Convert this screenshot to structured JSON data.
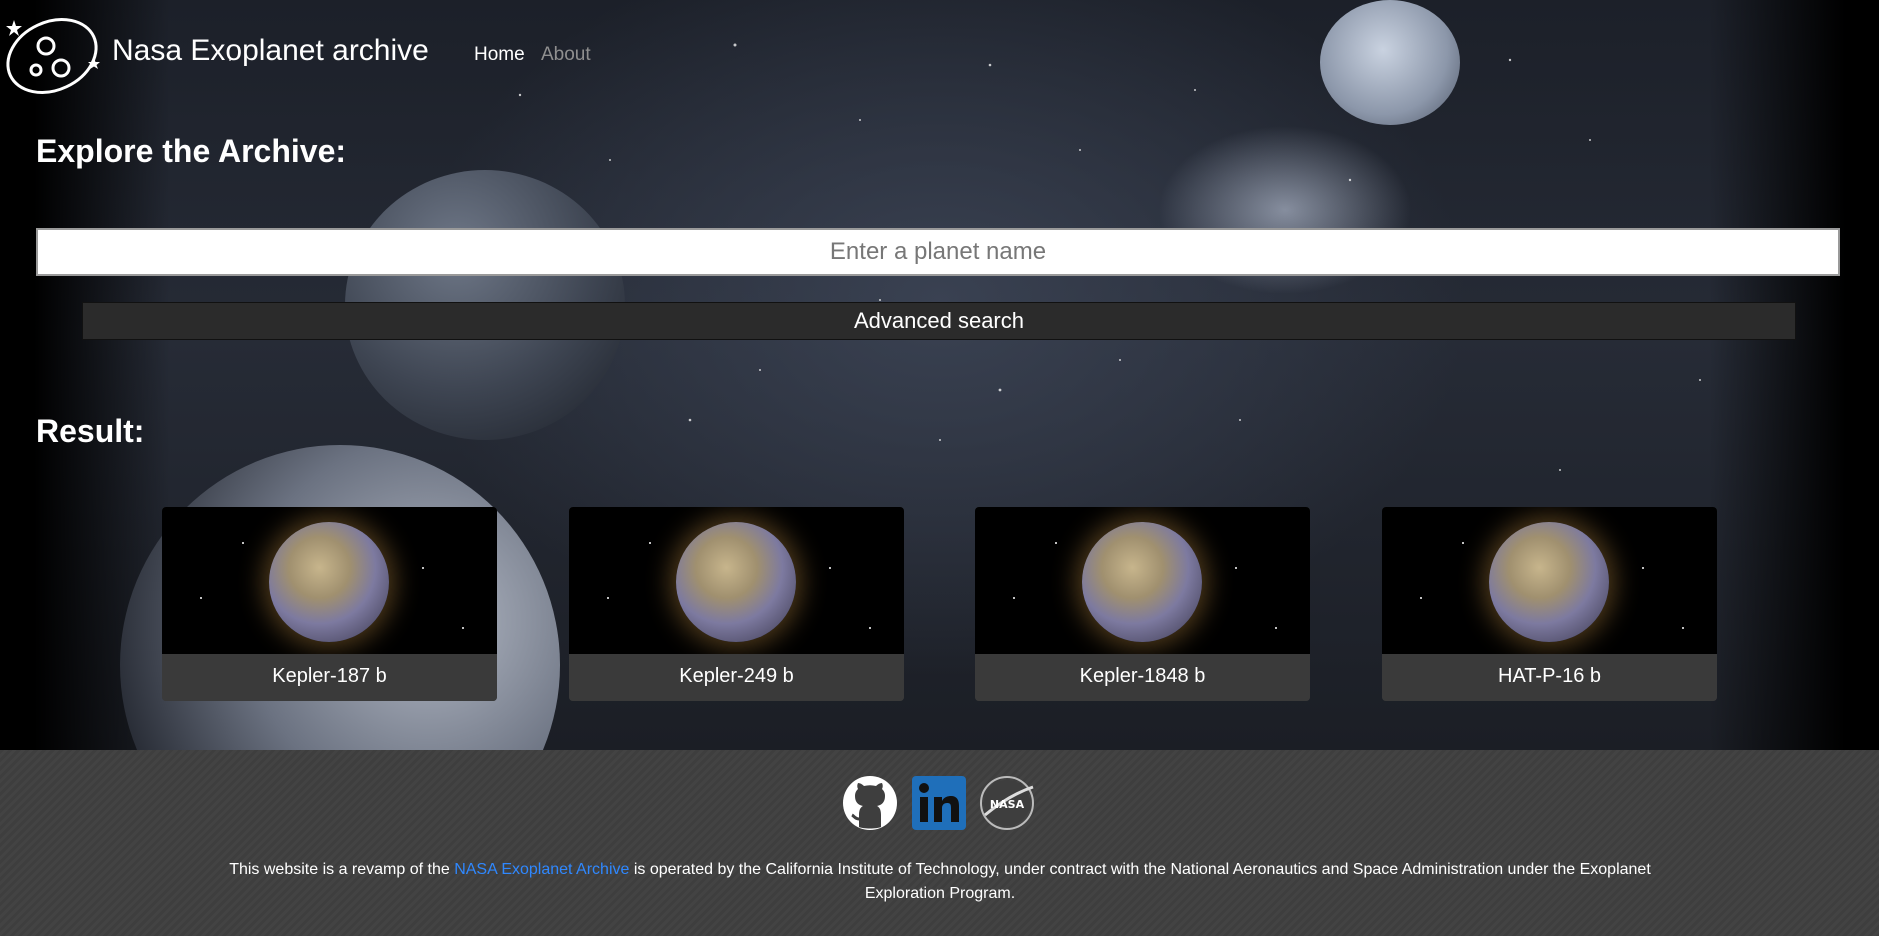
{
  "nav": {
    "brand": "Nasa Exoplanet archive",
    "links": [
      {
        "label": "Home",
        "active": true
      },
      {
        "label": "About",
        "active": false
      }
    ]
  },
  "explore": {
    "title": "Explore the Archive:",
    "search_placeholder": "Enter a planet name",
    "advanced_label": "Advanced search"
  },
  "results": {
    "title": "Result:",
    "cards": [
      {
        "name": "Kepler-187 b"
      },
      {
        "name": "Kepler-249 b"
      },
      {
        "name": "Kepler-1848 b"
      },
      {
        "name": "HAT-P-16 b"
      }
    ]
  },
  "footer": {
    "icons": [
      "github-icon",
      "linkedin-icon",
      "nasa-icon"
    ],
    "text_before": "This website is a revamp of the ",
    "link_text": "NASA Exoplanet Archive",
    "text_after": " is operated by the California Institute of Technology, under contract with the National Aeronautics and Space Administration under the Exoplanet Exploration Program."
  },
  "colors": {
    "background": "#000000",
    "footer": "#3e3e3e",
    "link": "#2f88ff",
    "button": "#2b2b2b",
    "card_label": "#3a3a3a"
  }
}
